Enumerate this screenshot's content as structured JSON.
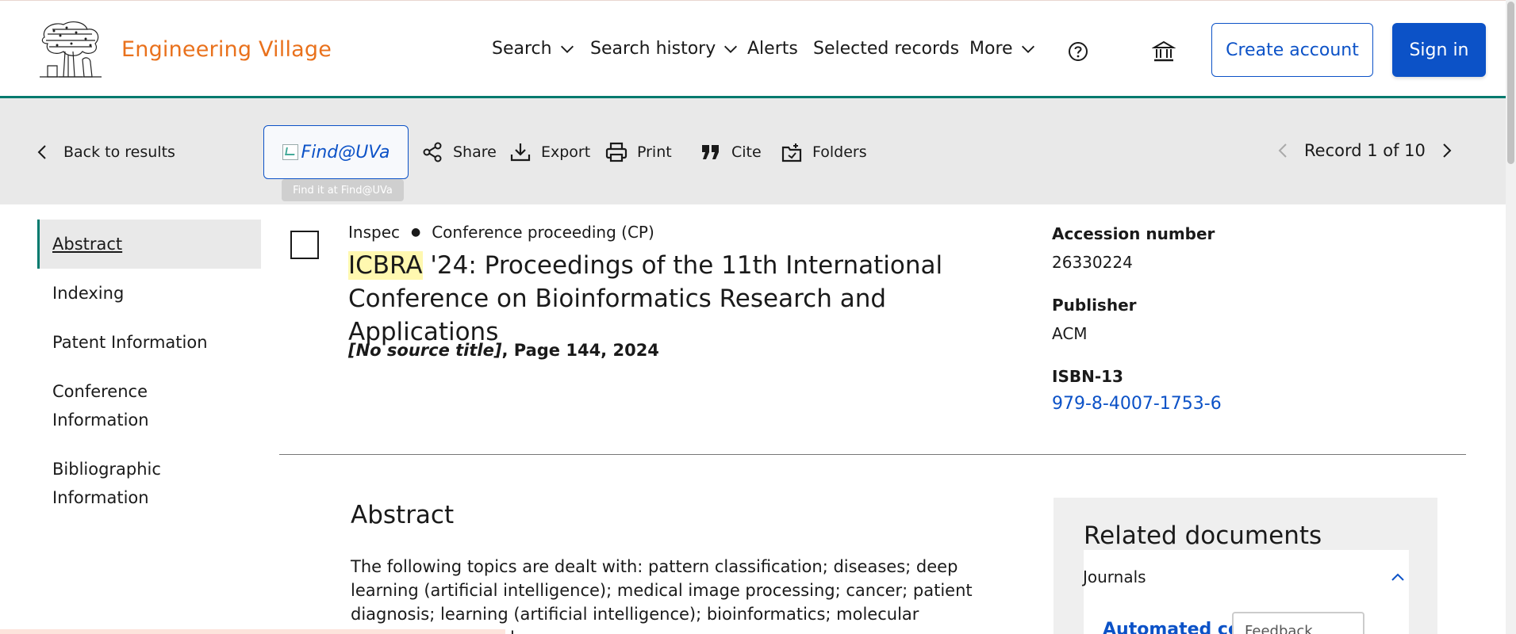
{
  "brand": {
    "name": "Engineering Village",
    "color": "#e9711c"
  },
  "nav": {
    "search": "Search",
    "search_history": "Search history",
    "alerts": "Alerts",
    "selected_records": "Selected records",
    "more": "More",
    "help_icon": "help-icon",
    "institution_icon": "institution-icon",
    "create_account": "Create account",
    "sign_in": "Sign in"
  },
  "toolbar": {
    "back": "Back to results",
    "find": "Find@UVa",
    "find_tooltip": "Find it at Find@UVa",
    "share": "Share",
    "export": "Export",
    "print": "Print",
    "cite": "Cite",
    "folders": "Folders",
    "record_position": "Record 1 of 10"
  },
  "sidenav": {
    "items": [
      {
        "label": "Abstract",
        "active": true
      },
      {
        "label": "Indexing"
      },
      {
        "label": "Patent Information"
      },
      {
        "label": "Conference Information"
      },
      {
        "label": "Bibliographic Information"
      }
    ]
  },
  "record": {
    "database": "Inspec",
    "doc_type": "Conference proceeding (CP)",
    "title_highlight": "ICBRA",
    "title_rest": " '24: Proceedings of the 11th International Conference on Bioinformatics Research and Applications",
    "source_title": "[No source title]",
    "source_rest": ", Page 144, 2024"
  },
  "details": {
    "accession_label": "Accession number",
    "accession_value": "26330224",
    "publisher_label": "Publisher",
    "publisher_value": "ACM",
    "isbn_label": "ISBN-13",
    "isbn_value": "979-8-4007-1753-6"
  },
  "abstract": {
    "heading": "Abstract",
    "text": "The following topics are dealt with: pattern classification; diseases; deep learning (artificial intelligence); medical image processing; cancer; patient diagnosis; learning (artificial intelligence); bioinformatics; molecular biophysics; medical"
  },
  "related": {
    "heading": "Related documents",
    "section": "Journals",
    "first_link": "Automated co",
    "feedback": "Feedback"
  },
  "colors": {
    "accent": "#0c52c7",
    "header_border": "#007a6e",
    "toolbar_bg": "#e9e9e9",
    "highlight": "#fff8b0"
  }
}
